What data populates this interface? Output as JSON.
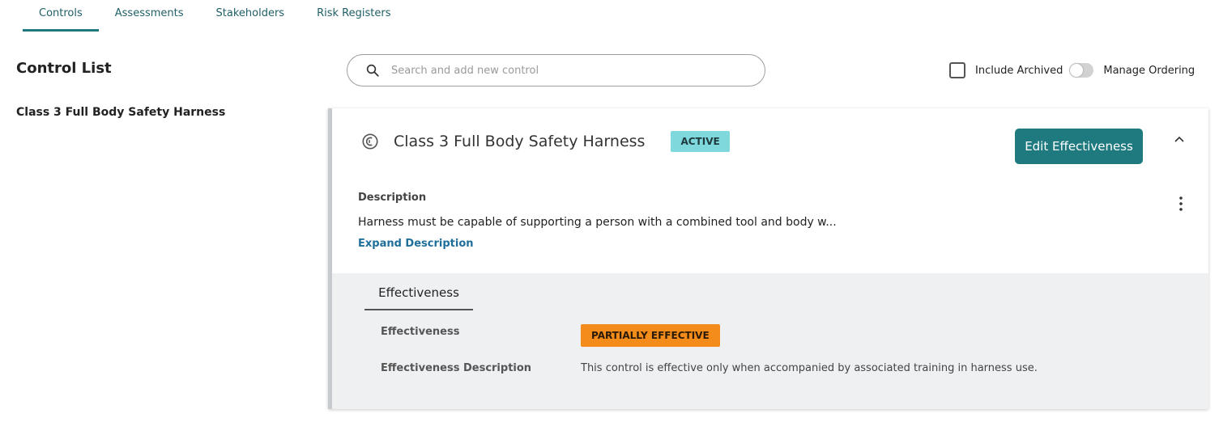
{
  "tabs": [
    {
      "label": "Controls",
      "active": true
    },
    {
      "label": "Assessments"
    },
    {
      "label": "Stakeholders"
    },
    {
      "label": "Risk Registers"
    }
  ],
  "control_list": {
    "title": "Control List",
    "items": [
      "Class 3 Full Body Safety Harness"
    ]
  },
  "search": {
    "placeholder": "Search and add new control",
    "icon": "search-icon"
  },
  "options": {
    "include_archived_label": "Include Archived",
    "include_archived_checked": false,
    "manage_ordering_label": "Manage Ordering",
    "manage_ordering_on": false
  },
  "control": {
    "title": "Class 3 Full Body Safety Harness",
    "status": "ACTIVE",
    "edit_button": "Edit Effectiveness",
    "description_label": "Description",
    "description": "Harness must be capable of supporting a person with a combined tool and body w...",
    "expand_label": "Expand Description",
    "effectiveness_tab": "Effectiveness",
    "effectiveness_label": "Effectiveness",
    "effectiveness_value": "PARTIALLY EFFECTIVE",
    "effectiveness_description_label": "Effectiveness Description",
    "effectiveness_description": "This control is effective only when accompanied by associated training in harness use."
  },
  "colors": {
    "accent": "#1f7a80",
    "active_badge": "#7fd8dc",
    "partial_badge": "#f38c1a",
    "link": "#1f6f9a"
  }
}
